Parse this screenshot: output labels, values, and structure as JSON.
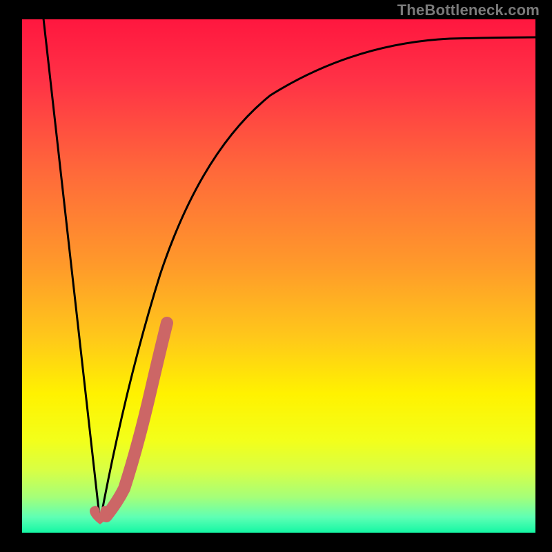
{
  "watermark": "TheBottleneck.com",
  "colors": {
    "frame": "#000000",
    "curve": "#000000",
    "highlight": "#cc6666",
    "gradient_top": "#ff173f",
    "gradient_mid": "#fff200",
    "gradient_bottom": "#14f7a4",
    "watermark_text": "#7a7a7a"
  },
  "chart_data": {
    "type": "line",
    "title": "",
    "xlabel": "",
    "ylabel": "",
    "xlim": [
      0,
      100
    ],
    "ylim": [
      0,
      100
    ],
    "series": [
      {
        "name": "left-line",
        "x": [
          4,
          15
        ],
        "y": [
          101,
          2
        ]
      },
      {
        "name": "rising-curve",
        "x": [
          15,
          20,
          27,
          35,
          48,
          65,
          83,
          100
        ],
        "y": [
          2,
          29,
          50,
          74,
          85,
          95,
          96.5,
          97
        ]
      },
      {
        "name": "highlight-segment",
        "x": [
          16,
          20,
          25,
          28
        ],
        "y": [
          3,
          9,
          27,
          41
        ]
      }
    ],
    "markers": [
      {
        "name": "heart-marker",
        "x": 15,
        "y": 3
      }
    ],
    "background": {
      "style": "vertical-gradient",
      "semantic": "red-top-to-green-bottom (bottleneck severity scale)"
    }
  }
}
